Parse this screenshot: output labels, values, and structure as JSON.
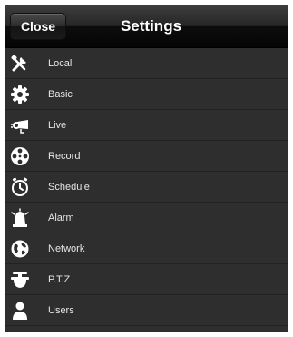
{
  "navbar": {
    "title": "Settings",
    "close_label": "Close"
  },
  "menu": {
    "items": [
      {
        "label": "Local",
        "icon": "tools-icon"
      },
      {
        "label": "Basic",
        "icon": "gear-icon"
      },
      {
        "label": "Live",
        "icon": "camera-icon"
      },
      {
        "label": "Record",
        "icon": "film-reel-icon"
      },
      {
        "label": "Schedule",
        "icon": "clock-icon"
      },
      {
        "label": "Alarm",
        "icon": "alarm-icon"
      },
      {
        "label": "Network",
        "icon": "globe-icon"
      },
      {
        "label": "P.T.Z",
        "icon": "dome-camera-icon"
      },
      {
        "label": "Users",
        "icon": "user-icon"
      }
    ]
  },
  "colors": {
    "background": "#2e2e2e",
    "text": "#e6e6e6",
    "icon": "#ffffff"
  }
}
